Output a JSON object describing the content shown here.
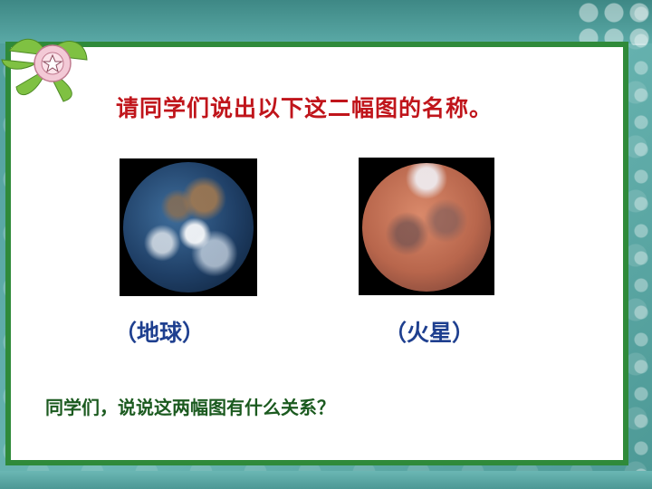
{
  "slide": {
    "title": "请同学们说出以下这二幅图的名称。",
    "planets": [
      {
        "label": "（地球）",
        "image": "earth-image"
      },
      {
        "label": "（火星）",
        "image": "mars-image"
      }
    ],
    "question": "同学们，说说这两幅图有什么关系？"
  },
  "colors": {
    "background_teal": "#5aa9a6",
    "frame_green": "#2f8a3a",
    "title_red": "#c0151b",
    "label_blue": "#1e3f8f",
    "question_green": "#1b5a1f"
  },
  "icons": {
    "corner_decoration": "flower-icon"
  }
}
